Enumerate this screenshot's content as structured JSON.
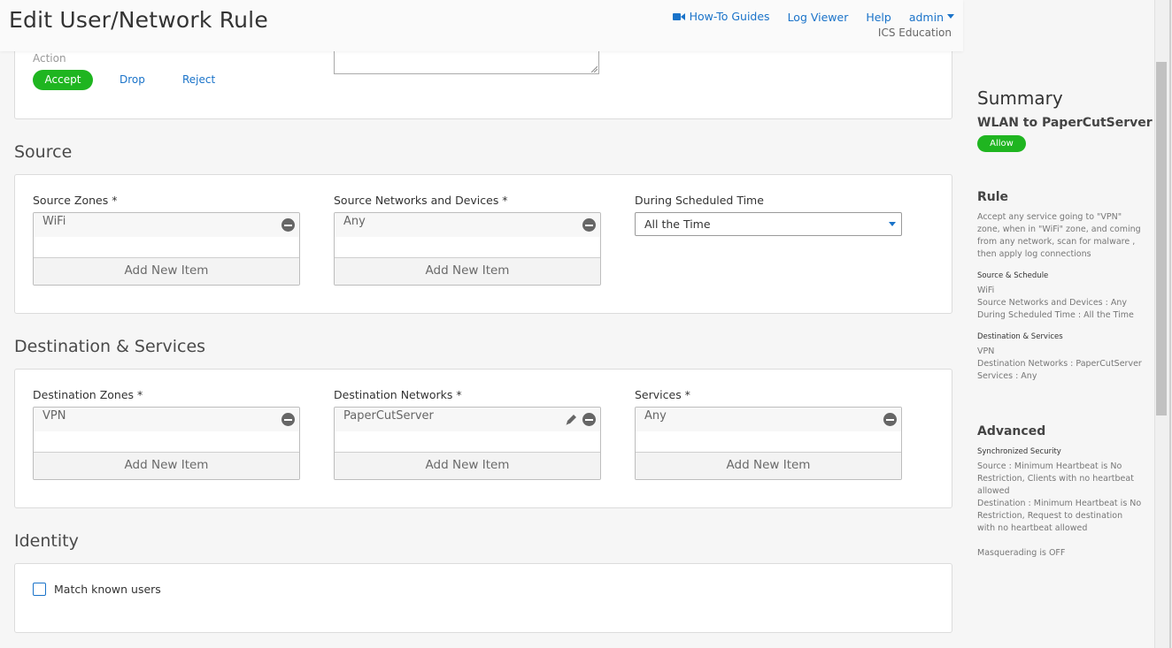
{
  "header": {
    "title": "Edit User/Network Rule",
    "links": {
      "howto": "How-To Guides",
      "logviewer": "Log Viewer",
      "help": "Help",
      "admin": "admin"
    },
    "org": "ICS Education"
  },
  "action": {
    "label": "Action",
    "accept": "Accept",
    "drop": "Drop",
    "reject": "Reject"
  },
  "source": {
    "title": "Source",
    "zones_label": "Source Zones *",
    "zones_item": "WiFi",
    "networks_label": "Source Networks and Devices *",
    "networks_item": "Any",
    "schedule_label": "During Scheduled Time",
    "schedule_value": "All the Time",
    "add_label": "Add New Item"
  },
  "destination": {
    "title": "Destination & Services",
    "zones_label": "Destination Zones *",
    "zones_item": "VPN",
    "networks_label": "Destination Networks *",
    "networks_item": "PaperCutServer",
    "services_label": "Services *",
    "services_item": "Any",
    "add_label": "Add New Item"
  },
  "identity": {
    "title": "Identity",
    "match_label": "Match known users"
  },
  "summary": {
    "title": "Summary",
    "rule_name": "WLAN to PaperCutServer",
    "badge": "Allow",
    "rule_heading": "Rule",
    "rule_text": "Accept any service going to \"VPN\" zone, when in \"WiFi\" zone, and coming from any network, scan for malware , then apply log connections",
    "src_heading": "Source & Schedule",
    "src_line1": "WiFi",
    "src_line2": "Source Networks and Devices : Any",
    "src_line3": "During Scheduled Time : All the Time",
    "dst_heading": "Destination & Services",
    "dst_line1": "VPN",
    "dst_line2": "Destination Networks : PaperCutServer",
    "dst_line3": "Services : Any",
    "adv_heading": "Advanced",
    "adv_sub": "Synchronized Security",
    "adv_src": "Source : Minimum Heartbeat is No Restriction, Clients with no heartbeat allowed",
    "adv_dst": "Destination : Minimum Heartbeat is No Restriction, Request to destination with no heartbeat allowed",
    "adv_masq": "Masquerading is OFF"
  },
  "colors": {
    "accent": "#1a73c9",
    "allow": "#1fb520"
  }
}
